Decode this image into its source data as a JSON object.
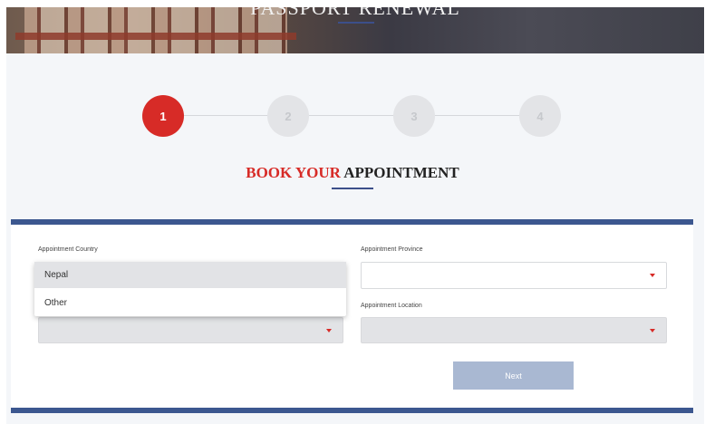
{
  "banner": {
    "title": "PASSPORT RENEWAL"
  },
  "steps": [
    "1",
    "2",
    "3",
    "4"
  ],
  "heading": {
    "red": "BOOK YOUR",
    "dark": "APPOINTMENT"
  },
  "form": {
    "country_label": "Appointment Country",
    "province_label": "Appointment Province",
    "location_label": "Appointment Location",
    "country_options": [
      "Nepal",
      "Other"
    ],
    "next_label": "Next"
  },
  "colors": {
    "accent_red": "#d72b27",
    "accent_blue": "#3c578f",
    "button_disabled": "#a9b8d2"
  }
}
